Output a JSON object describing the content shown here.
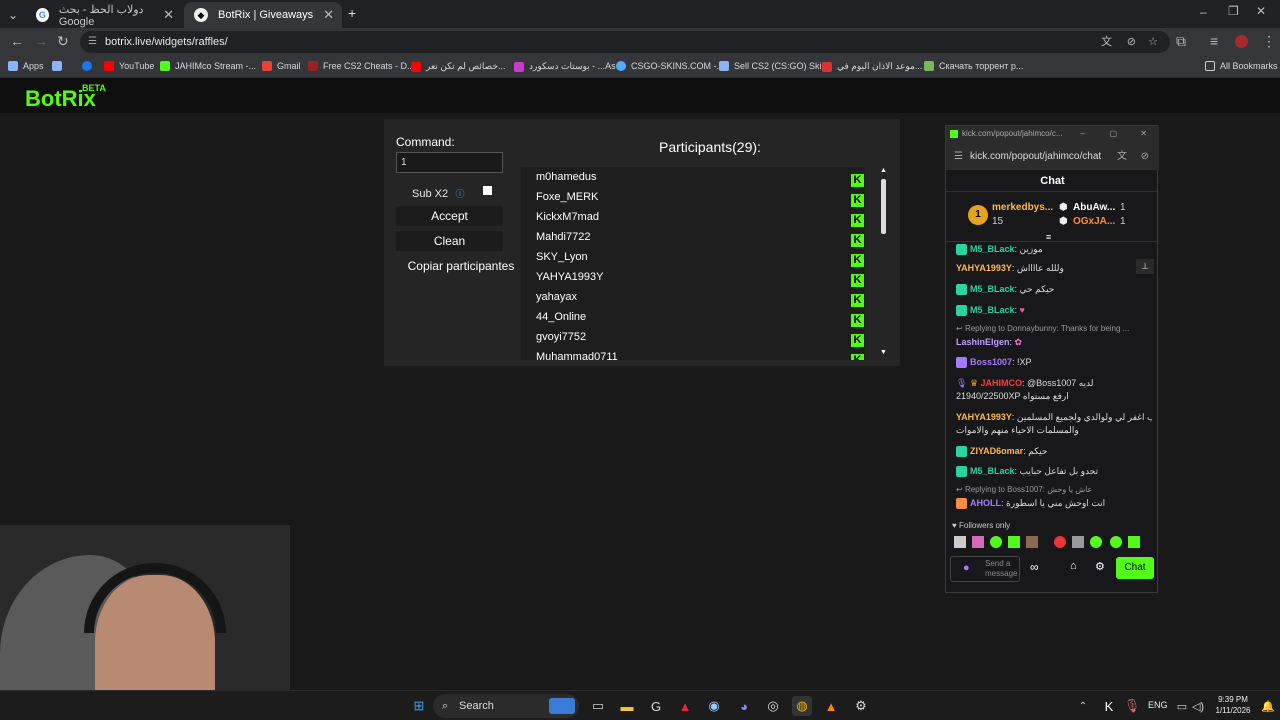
{
  "tabs": [
    {
      "title": "دولاب الحظ - بحث Google",
      "active": false
    },
    {
      "title": "BotRix | Giveaways",
      "active": true
    }
  ],
  "address": {
    "url": "botrix.live/widgets/raffles/"
  },
  "bookmarks": [
    {
      "label": "Apps",
      "icon": "grid-icon",
      "color": "#8ab4f8"
    },
    {
      "label": "",
      "icon": "google-apps-icon",
      "color": "#8ab4f8"
    },
    {
      "label": "",
      "icon": "facebook-icon",
      "color": "#1877f2"
    },
    {
      "label": "YouTube",
      "icon": "youtube-icon",
      "color": "#ff0000"
    },
    {
      "label": "JAHIMco Stream -...",
      "icon": "kick-icon",
      "color": "#53fc18"
    },
    {
      "label": "Gmail",
      "icon": "gmail-icon",
      "color": "#ea4335"
    },
    {
      "label": "Free CS2 Cheats - D...",
      "icon": "cheats-icon",
      "color": "#9b2222"
    },
    {
      "label": "خصائص لم تكن تعر...",
      "icon": "youtube-icon",
      "color": "#ff0000"
    },
    {
      "label": "بوستات دسكورد - ...As",
      "icon": "site-icon",
      "color": "#c93ad1"
    },
    {
      "label": "CSGO-SKINS.COM -...",
      "icon": "site-icon",
      "color": "#55aaff"
    },
    {
      "label": "Sell CS2 (CS:GO) Ski...",
      "icon": "site-icon",
      "color": "#8ab4f8"
    },
    {
      "label": "موعد الاذان اليوم في...",
      "icon": "site-icon",
      "color": "#d33"
    },
    {
      "label": "Скачать торрент р...",
      "icon": "site-icon",
      "color": "#7bb661"
    },
    {
      "label": "All Bookmarks",
      "icon": "folder-icon",
      "color": "#ccc"
    }
  ],
  "app": {
    "logo": "BotRix",
    "beta": "BETA"
  },
  "raffle": {
    "command_label": "Command:",
    "command_value": "1",
    "sub_label": "Sub X2",
    "accept": "Accept",
    "clean": "Clean",
    "copy": "Copiar participantes",
    "participants_title": "Participants(29):",
    "participants": [
      "m0hamedus",
      "Foxe_MERK",
      "KickxM7mad",
      "Mahdi7722",
      "SKY_Lyon",
      "YAHYA1993Y",
      "yahayax",
      "44_Online",
      "gvoyi7752",
      "Muhammad0711"
    ]
  },
  "kick": {
    "window_title": "kick.com/popout/jahimco/c...",
    "url": "kick.com/popout/jahimco/chat",
    "chat_title": "Chat",
    "leader": {
      "rank": "1",
      "name1": "merkedbys...",
      "count1": "15",
      "name2": "AbuAw...",
      "c2": "1",
      "name3": "OGxJA...",
      "c3": "1"
    },
    "messages": [
      {
        "user": "M5_BLack",
        "text": "موزين",
        "color": "#2ad4a0"
      },
      {
        "user": "YAHYA1993Y",
        "text": "وللله عااااش",
        "color": "#ffb84d"
      },
      {
        "user": "M5_BLack",
        "text": "حيكم حي",
        "color": "#2ad4a0"
      },
      {
        "user": "M5_BLack",
        "text": "",
        "color": "#2ad4a0"
      },
      {
        "user": "",
        "text": "Replying to Donnaybunny: Thanks for being ...",
        "color": "#999"
      },
      {
        "user": "LashinElgen",
        "text": "",
        "color": "#c59cff"
      },
      {
        "user": "Boss1007",
        "text": "!XP",
        "color": "#a77bff"
      },
      {
        "user": "JAHIMCO",
        "text": "@Boss1007 لديه",
        "color": "#ff3c3c"
      },
      {
        "user": "",
        "text": "21940/22500XP ارفع مستواه",
        "color": "#ddd"
      },
      {
        "user": "YAHYA1993Y",
        "text": "رب اغفر لي ولوالدي ولجميع المسلمين",
        "color": "#ffb84d"
      },
      {
        "user": "",
        "text": "والمسلمات الاحياء منهم والاموات",
        "color": "#ddd"
      },
      {
        "user": "ZIYAD6omar",
        "text": "حيكم",
        "color": "#ffb84d"
      },
      {
        "user": "M5_BLack",
        "text": "تحدو بل تفاعل حبايب",
        "color": "#2ad4a0"
      },
      {
        "user": "",
        "text": "Replying to Boss1007: عاش يا وحش",
        "color": "#999"
      },
      {
        "user": "AHOLL",
        "text": "انت اوحش مني يا اسطورة",
        "color": "#a77bff"
      }
    ],
    "followers_only": "Followers only",
    "input_placeholder": "Send a message",
    "send": "Chat"
  },
  "taskbar": {
    "search": "Search",
    "lang": "ENG",
    "time": "9:39 PM",
    "date": "1/11/2026"
  }
}
